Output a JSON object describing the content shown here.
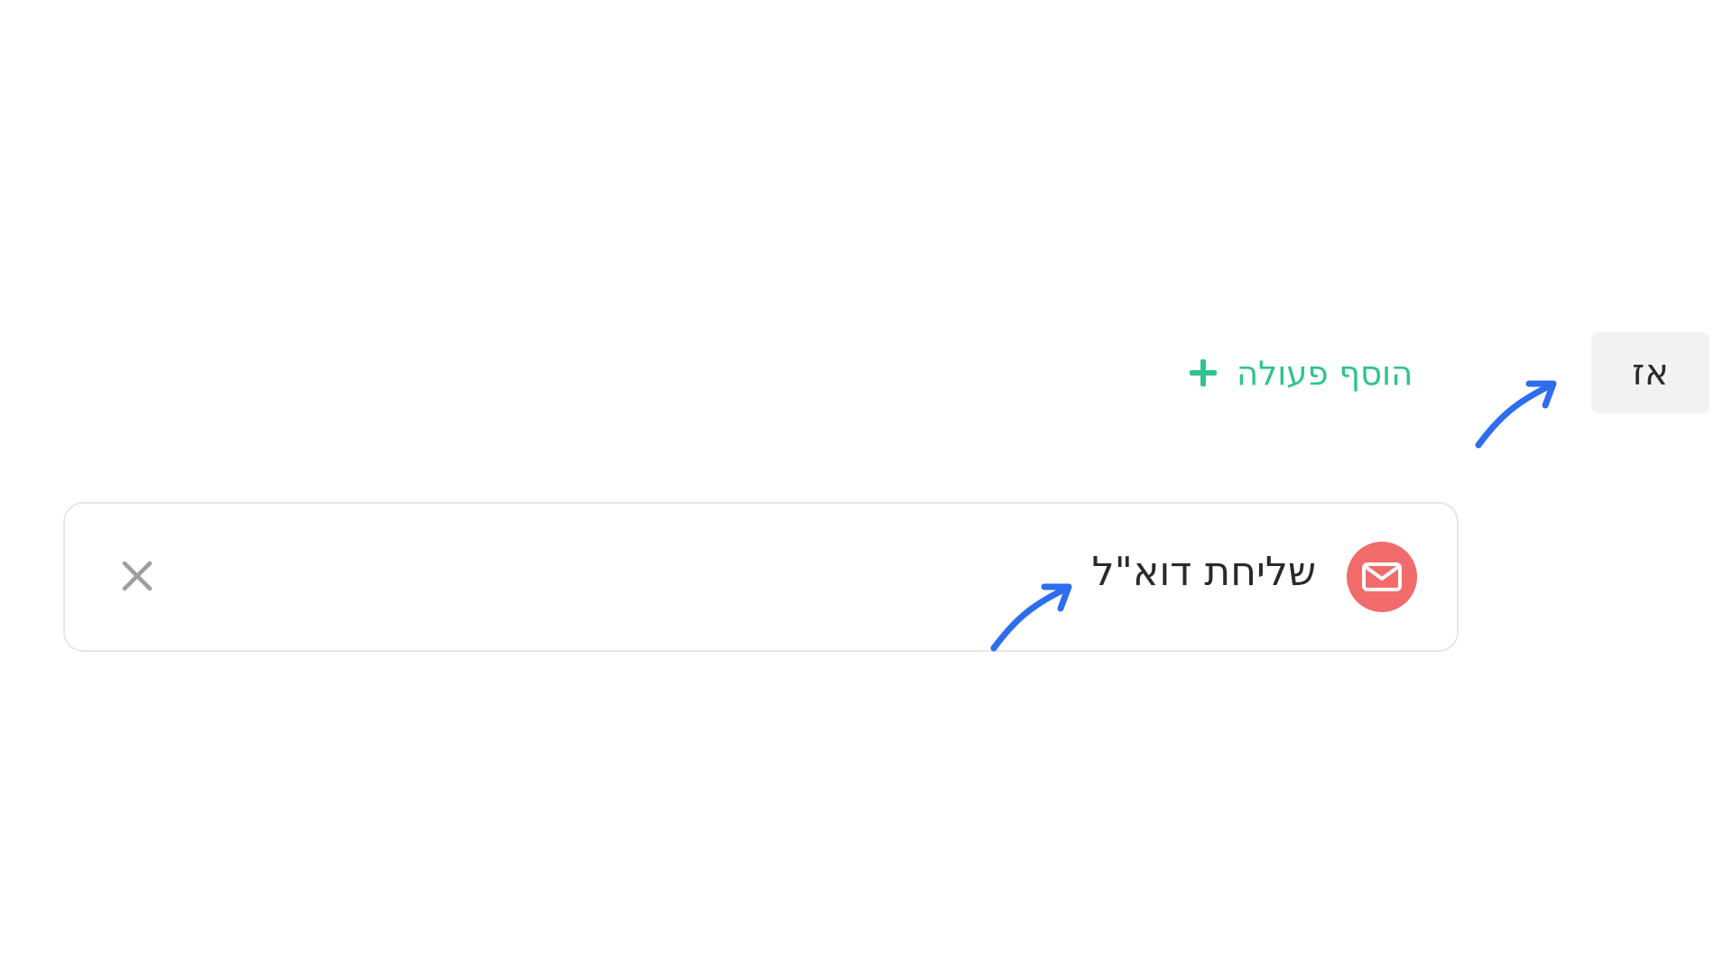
{
  "then_label": "אז",
  "add_action": {
    "label": "הוסף פעולה",
    "icon": "plus-icon"
  },
  "action": {
    "label": "שליחת דוא\"ל",
    "icon": "mail-icon",
    "remove_icon": "close-icon"
  },
  "annotations": {
    "arrow_color": "#2f6df0",
    "arrows": [
      "arrow-icon",
      "arrow-icon"
    ]
  },
  "colors": {
    "accent_green": "#2fc48c",
    "mail_red": "#f26b6b",
    "chip_bg": "#f2f2f2"
  }
}
